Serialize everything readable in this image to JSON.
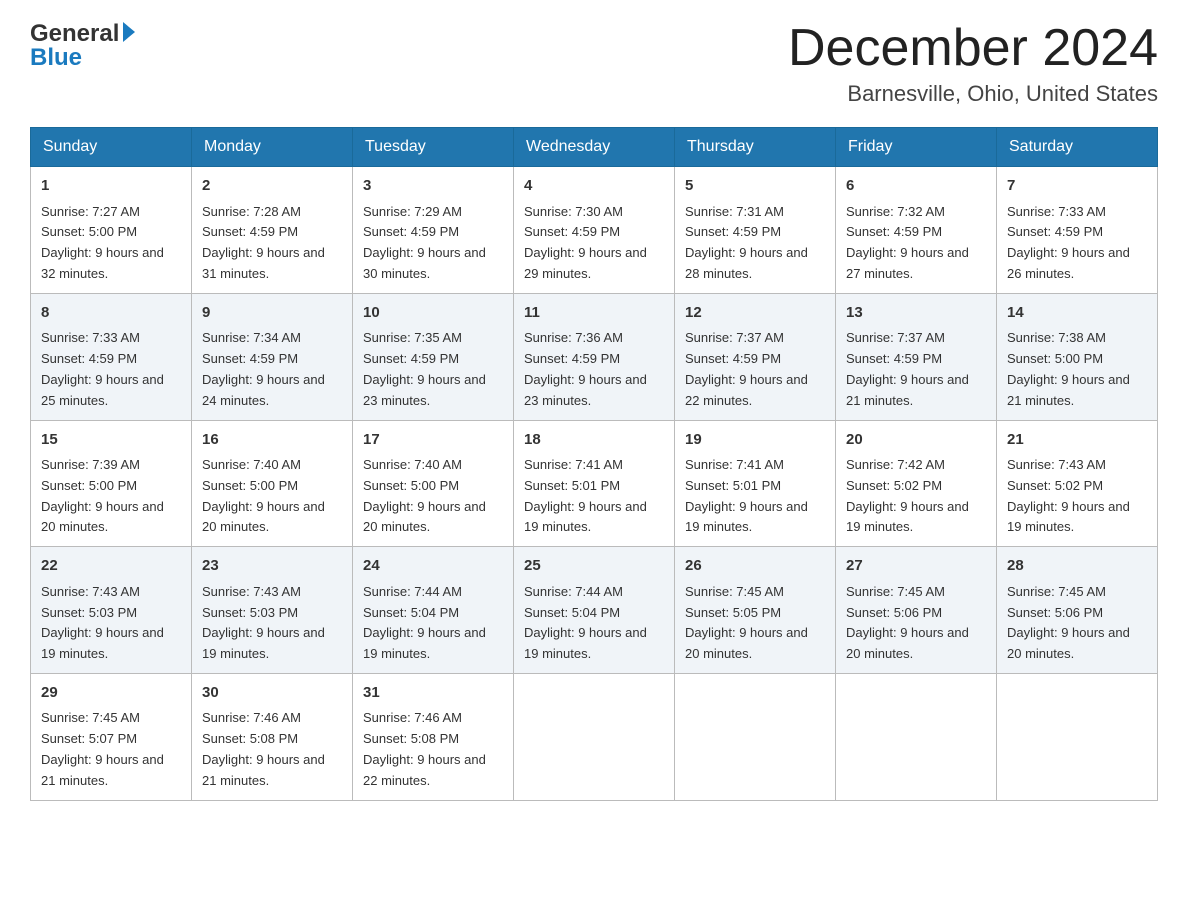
{
  "header": {
    "logo_general": "General",
    "logo_blue": "Blue",
    "month_title": "December 2024",
    "location": "Barnesville, Ohio, United States"
  },
  "days_of_week": [
    "Sunday",
    "Monday",
    "Tuesday",
    "Wednesday",
    "Thursday",
    "Friday",
    "Saturday"
  ],
  "weeks": [
    [
      {
        "day": "1",
        "sunrise": "7:27 AM",
        "sunset": "5:00 PM",
        "daylight": "9 hours and 32 minutes."
      },
      {
        "day": "2",
        "sunrise": "7:28 AM",
        "sunset": "4:59 PM",
        "daylight": "9 hours and 31 minutes."
      },
      {
        "day": "3",
        "sunrise": "7:29 AM",
        "sunset": "4:59 PM",
        "daylight": "9 hours and 30 minutes."
      },
      {
        "day": "4",
        "sunrise": "7:30 AM",
        "sunset": "4:59 PM",
        "daylight": "9 hours and 29 minutes."
      },
      {
        "day": "5",
        "sunrise": "7:31 AM",
        "sunset": "4:59 PM",
        "daylight": "9 hours and 28 minutes."
      },
      {
        "day": "6",
        "sunrise": "7:32 AM",
        "sunset": "4:59 PM",
        "daylight": "9 hours and 27 minutes."
      },
      {
        "day": "7",
        "sunrise": "7:33 AM",
        "sunset": "4:59 PM",
        "daylight": "9 hours and 26 minutes."
      }
    ],
    [
      {
        "day": "8",
        "sunrise": "7:33 AM",
        "sunset": "4:59 PM",
        "daylight": "9 hours and 25 minutes."
      },
      {
        "day": "9",
        "sunrise": "7:34 AM",
        "sunset": "4:59 PM",
        "daylight": "9 hours and 24 minutes."
      },
      {
        "day": "10",
        "sunrise": "7:35 AM",
        "sunset": "4:59 PM",
        "daylight": "9 hours and 23 minutes."
      },
      {
        "day": "11",
        "sunrise": "7:36 AM",
        "sunset": "4:59 PM",
        "daylight": "9 hours and 23 minutes."
      },
      {
        "day": "12",
        "sunrise": "7:37 AM",
        "sunset": "4:59 PM",
        "daylight": "9 hours and 22 minutes."
      },
      {
        "day": "13",
        "sunrise": "7:37 AM",
        "sunset": "4:59 PM",
        "daylight": "9 hours and 21 minutes."
      },
      {
        "day": "14",
        "sunrise": "7:38 AM",
        "sunset": "5:00 PM",
        "daylight": "9 hours and 21 minutes."
      }
    ],
    [
      {
        "day": "15",
        "sunrise": "7:39 AM",
        "sunset": "5:00 PM",
        "daylight": "9 hours and 20 minutes."
      },
      {
        "day": "16",
        "sunrise": "7:40 AM",
        "sunset": "5:00 PM",
        "daylight": "9 hours and 20 minutes."
      },
      {
        "day": "17",
        "sunrise": "7:40 AM",
        "sunset": "5:00 PM",
        "daylight": "9 hours and 20 minutes."
      },
      {
        "day": "18",
        "sunrise": "7:41 AM",
        "sunset": "5:01 PM",
        "daylight": "9 hours and 19 minutes."
      },
      {
        "day": "19",
        "sunrise": "7:41 AM",
        "sunset": "5:01 PM",
        "daylight": "9 hours and 19 minutes."
      },
      {
        "day": "20",
        "sunrise": "7:42 AM",
        "sunset": "5:02 PM",
        "daylight": "9 hours and 19 minutes."
      },
      {
        "day": "21",
        "sunrise": "7:43 AM",
        "sunset": "5:02 PM",
        "daylight": "9 hours and 19 minutes."
      }
    ],
    [
      {
        "day": "22",
        "sunrise": "7:43 AM",
        "sunset": "5:03 PM",
        "daylight": "9 hours and 19 minutes."
      },
      {
        "day": "23",
        "sunrise": "7:43 AM",
        "sunset": "5:03 PM",
        "daylight": "9 hours and 19 minutes."
      },
      {
        "day": "24",
        "sunrise": "7:44 AM",
        "sunset": "5:04 PM",
        "daylight": "9 hours and 19 minutes."
      },
      {
        "day": "25",
        "sunrise": "7:44 AM",
        "sunset": "5:04 PM",
        "daylight": "9 hours and 19 minutes."
      },
      {
        "day": "26",
        "sunrise": "7:45 AM",
        "sunset": "5:05 PM",
        "daylight": "9 hours and 20 minutes."
      },
      {
        "day": "27",
        "sunrise": "7:45 AM",
        "sunset": "5:06 PM",
        "daylight": "9 hours and 20 minutes."
      },
      {
        "day": "28",
        "sunrise": "7:45 AM",
        "sunset": "5:06 PM",
        "daylight": "9 hours and 20 minutes."
      }
    ],
    [
      {
        "day": "29",
        "sunrise": "7:45 AM",
        "sunset": "5:07 PM",
        "daylight": "9 hours and 21 minutes."
      },
      {
        "day": "30",
        "sunrise": "7:46 AM",
        "sunset": "5:08 PM",
        "daylight": "9 hours and 21 minutes."
      },
      {
        "day": "31",
        "sunrise": "7:46 AM",
        "sunset": "5:08 PM",
        "daylight": "9 hours and 22 minutes."
      },
      null,
      null,
      null,
      null
    ]
  ],
  "labels": {
    "sunrise": "Sunrise:",
    "sunset": "Sunset:",
    "daylight": "Daylight:"
  }
}
